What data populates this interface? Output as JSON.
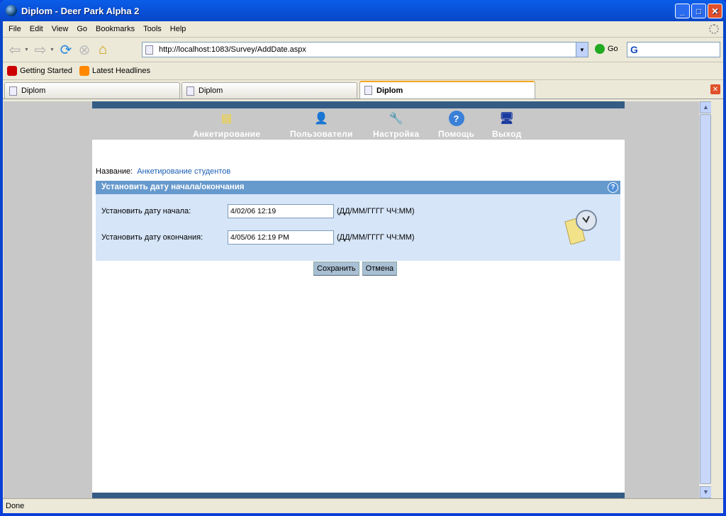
{
  "window": {
    "title": "Diplom - Deer Park Alpha 2"
  },
  "menu": [
    "File",
    "Edit",
    "View",
    "Go",
    "Bookmarks",
    "Tools",
    "Help"
  ],
  "toolbar": {
    "url": "http://localhost:1083/Survey/AddDate.aspx",
    "go_label": "Go",
    "search_value": "G"
  },
  "bookmarks": [
    "Getting Started",
    "Latest Headlines"
  ],
  "tabs": [
    {
      "label": "Diplom"
    },
    {
      "label": "Diplom"
    },
    {
      "label": "Diplom",
      "active": true
    }
  ],
  "site_nav": [
    "Анкетирование",
    "Пользователи",
    "Настройка",
    "Помощь",
    "Выход"
  ],
  "form": {
    "name_label": "Название:",
    "name_value": "Анкетирование студентов",
    "panel_title": "Установить дату начала/окончания",
    "start_label": "Установить дату начала:",
    "start_value": "4/02/06 12:19",
    "end_label": "Установить дату окончания:",
    "end_value": "4/05/06 12:19 PM",
    "format_hint": "(ДД/ММ/ГГГГ ЧЧ:ММ)",
    "save_label": "Сохранить",
    "cancel_label": "Отмена"
  },
  "status": "Done"
}
